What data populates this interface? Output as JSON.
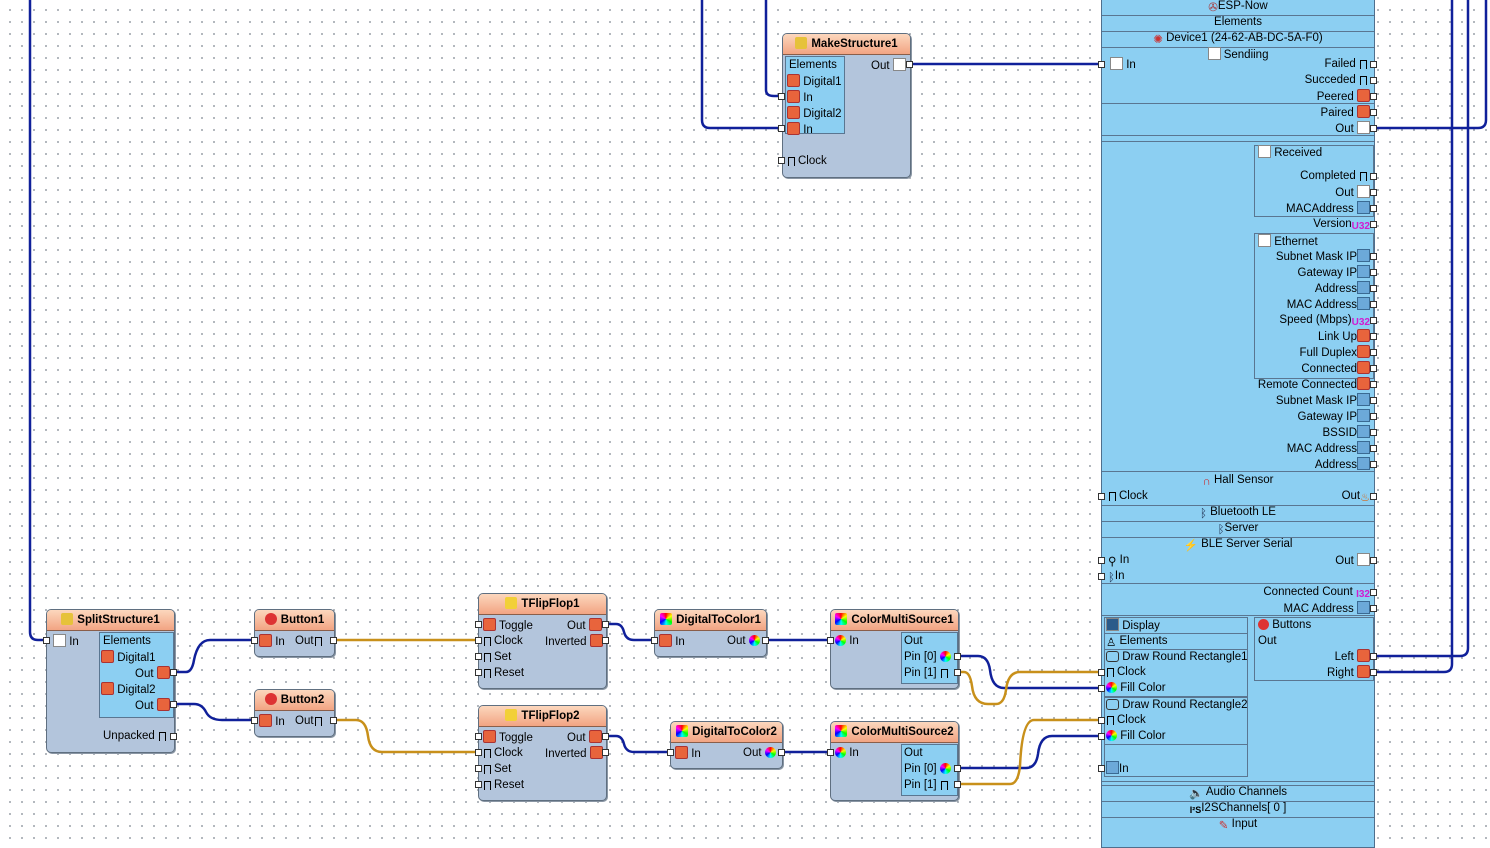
{
  "makeStructure": {
    "title": "MakeStructure1",
    "elements": "Elements",
    "digital1": "Digital1",
    "digital2": "Digital2",
    "in": "In",
    "out": "Out",
    "clock": "Clock"
  },
  "splitStructure": {
    "title": "SplitStructure1",
    "in": "In",
    "elements": "Elements",
    "digital1": "Digital1",
    "digital2": "Digital2",
    "out": "Out",
    "unpacked": "Unpacked"
  },
  "button1": {
    "title": "Button1",
    "in": "In",
    "out": "Out"
  },
  "button2": {
    "title": "Button2",
    "in": "In",
    "out": "Out"
  },
  "tflipflop1": {
    "title": "TFlipFlop1",
    "toggle": "Toggle",
    "clock": "Clock",
    "set": "Set",
    "reset": "Reset",
    "out": "Out",
    "inverted": "Inverted"
  },
  "tflipflop2": {
    "title": "TFlipFlop2",
    "toggle": "Toggle",
    "clock": "Clock",
    "set": "Set",
    "reset": "Reset",
    "out": "Out",
    "inverted": "Inverted"
  },
  "digitalToColor1": {
    "title": "DigitalToColor1",
    "in": "In",
    "out": "Out"
  },
  "digitalToColor2": {
    "title": "DigitalToColor2",
    "in": "In",
    "out": "Out"
  },
  "colorMulti1": {
    "title": "ColorMultiSource1",
    "in": "In",
    "out": "Out",
    "pin0": "Pin [0]",
    "pin1": "Pin [1]"
  },
  "colorMulti2": {
    "title": "ColorMultiSource2",
    "in": "In",
    "out": "Out",
    "pin0": "Pin [0]",
    "pin1": "Pin [1]"
  },
  "board": {
    "espnow": "ESP-Now",
    "elements": "Elements",
    "device": "Device1 (24-62-AB-DC-5A-F0)",
    "sending": "Sendiing",
    "in": "In",
    "failed": "Failed",
    "succeded": "Succeded",
    "peered": "Peered",
    "paired": "Paired",
    "out": "Out",
    "received": "Received",
    "completed": "Completed",
    "macaddress": "MACAddress",
    "version": "Version",
    "ethernet": "Ethernet",
    "subnet_mask_ip": "Subnet Mask IP",
    "gateway_ip": "Gateway IP",
    "address": "Address",
    "mac_address": "MAC Address",
    "speed": "Speed (Mbps)",
    "link_up": "Link Up",
    "full_duplex": "Full Duplex",
    "connected": "Connected",
    "remote_connected": "Remote Connected",
    "bssid": "BSSID",
    "hall_sensor": "Hall Sensor",
    "clock": "Clock",
    "bluetooth_le": "Bluetooth LE",
    "server": "Server",
    "ble_server_serial": "BLE Server Serial",
    "connected_count": "Connected Count",
    "display": "Display",
    "draw_rect1": "Draw Round Rectangle1",
    "draw_rect2": "Draw Round Rectangle2",
    "fill_color": "Fill Color",
    "buttons": "Buttons",
    "left": "Left",
    "right": "Right",
    "audio_channels": "Audio Channels",
    "i2s_channels": "I2SChannels[ 0 ]",
    "input": "Input",
    "u32": "U32",
    "i32": "I32"
  },
  "colors": {
    "wire_digital": "#10209a",
    "wire_clock": "#c8901a",
    "title_bg": "#f6b08e",
    "component_bg": "#b3c5dc",
    "board_bg": "#8ccff2"
  }
}
